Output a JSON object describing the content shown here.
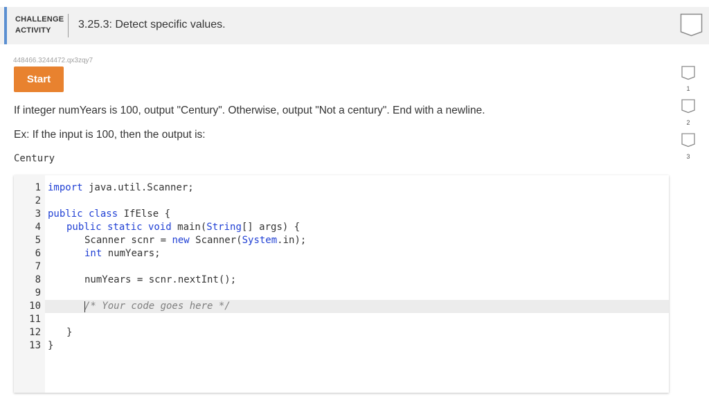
{
  "header": {
    "label_line1": "CHALLENGE",
    "label_line2": "ACTIVITY",
    "title": "3.25.3: Detect specific values."
  },
  "activity_id": "448466.3244472.qx3zqy7",
  "start_button": "Start",
  "instruction": "If integer numYears is 100, output \"Century\". Otherwise, output \"Not a century\". End with a newline.",
  "example": {
    "text": "Ex: If the input is 100, then the output is:",
    "output": "Century"
  },
  "editor": {
    "line_numbers": [
      "1",
      "2",
      "3",
      "4",
      "5",
      "6",
      "7",
      "8",
      "9",
      "10",
      "11",
      "12",
      "13"
    ],
    "lines": {
      "l1_kw": "import",
      "l1_rest": " java.util.Scanner;",
      "l3_kw": "public class",
      "l3_rest": " IfElse {",
      "l4_kw": "public static void",
      "l4_mid": " main(",
      "l4_type": "String",
      "l4_rest": "[] args) {",
      "l5_a": "Scanner scnr = ",
      "l5_kw": "new",
      "l5_b": " Scanner(",
      "l5_sys": "System",
      "l5_c": ".in);",
      "l6_kw": "int",
      "l6_rest": " numYears;",
      "l8": "numYears = scnr.nextInt();",
      "l10": "/* Your code goes here */",
      "l12": "}",
      "l13": "}"
    }
  },
  "levels": [
    "1",
    "2",
    "3"
  ],
  "colors": {
    "accent": "#5b8fd1",
    "start_button": "#e8822f",
    "keyword": "#1f3fd4"
  }
}
